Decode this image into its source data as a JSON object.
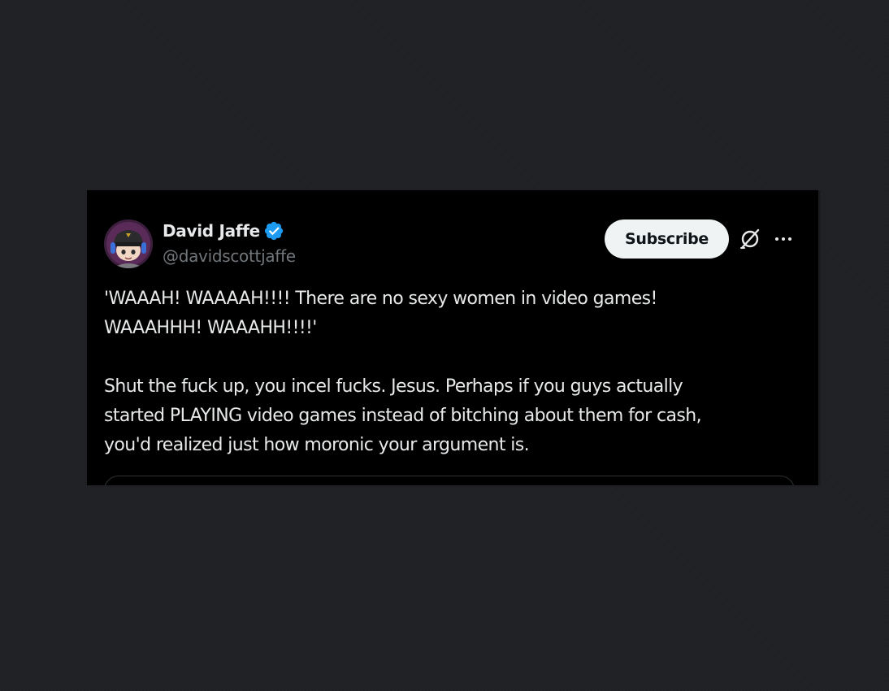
{
  "tweet": {
    "author": {
      "display_name": "David Jaffe",
      "handle": "@davidscottjaffe",
      "verified": true,
      "verified_color": "#1d9bf0",
      "avatar_icon": "cartoon-avatar-with-cap"
    },
    "subscribe_label": "Subscribe",
    "grok_icon": "grok-icon",
    "more_icon": "more-icon",
    "text": {
      "line1": "'WAAAH! WAAAAH!!!! There are no sexy women in video games!",
      "line2": "WAAAHHH! WAAAHH!!!!'",
      "line3": "Shut the fuck up, you incel fucks. Jesus. Perhaps if you guys actually",
      "line4": "started PLAYING video games instead of bitching about them for cash,",
      "line5": "you'd realized just how moronic your argument is."
    }
  },
  "colors": {
    "page_background": "#1f2024",
    "card_background": "#000000",
    "text_primary": "#e7e9ea",
    "text_secondary": "#71767b",
    "button_background": "#eff3f4",
    "button_text": "#0f1419"
  }
}
